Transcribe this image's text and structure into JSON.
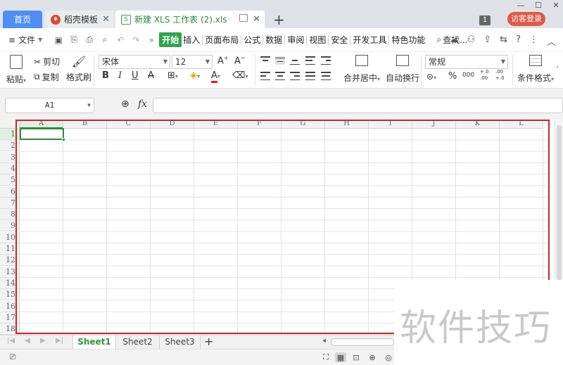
{
  "window": {
    "tabs": [
      {
        "label": "首页"
      },
      {
        "label": "稻壳模板"
      },
      {
        "label": "新建 XLS 工作表 (2).xls"
      }
    ],
    "window_count": "1",
    "login_label": "访客登录"
  },
  "menubar": {
    "file_label": "文件",
    "tabs": [
      "开始",
      "插入",
      "页面布局",
      "公式",
      "数据",
      "审阅",
      "视图",
      "安全",
      "开发工具",
      "特色功能"
    ],
    "find_label": "查找..."
  },
  "ribbon": {
    "paste": "粘贴",
    "cut": "剪切",
    "copy": "复制",
    "format_painter": "格式刷",
    "font_name": "宋体",
    "font_size": "12",
    "bold": "B",
    "italic": "I",
    "underline": "U",
    "merge_center": "合并居中",
    "wrap_text": "自动换行",
    "number_format": "常规",
    "percent": "%",
    "thousands": "000",
    "inc_decimal": "+.0 .00",
    "dec_decimal": ".00 +.0",
    "conditional_format": "条件格式"
  },
  "formula_bar": {
    "name_box": "A1",
    "fx_label": "fx",
    "formula": ""
  },
  "grid": {
    "columns": [
      "A",
      "B",
      "C",
      "D",
      "E",
      "F",
      "G",
      "H",
      "I",
      "J",
      "K",
      "L"
    ],
    "rows": [
      "1",
      "2",
      "3",
      "4",
      "5",
      "6",
      "7",
      "8",
      "9",
      "10",
      "11",
      "12",
      "13",
      "14",
      "15",
      "16",
      "17",
      "18"
    ],
    "active_cell": "A1",
    "highlight_color": "#c8262d",
    "accent_color": "#2f8a3a"
  },
  "sheets": {
    "tabs": [
      "Sheet1",
      "Sheet2",
      "Sheet3"
    ],
    "active": "Sheet1"
  },
  "watermark": {
    "text": "软件技巧"
  }
}
